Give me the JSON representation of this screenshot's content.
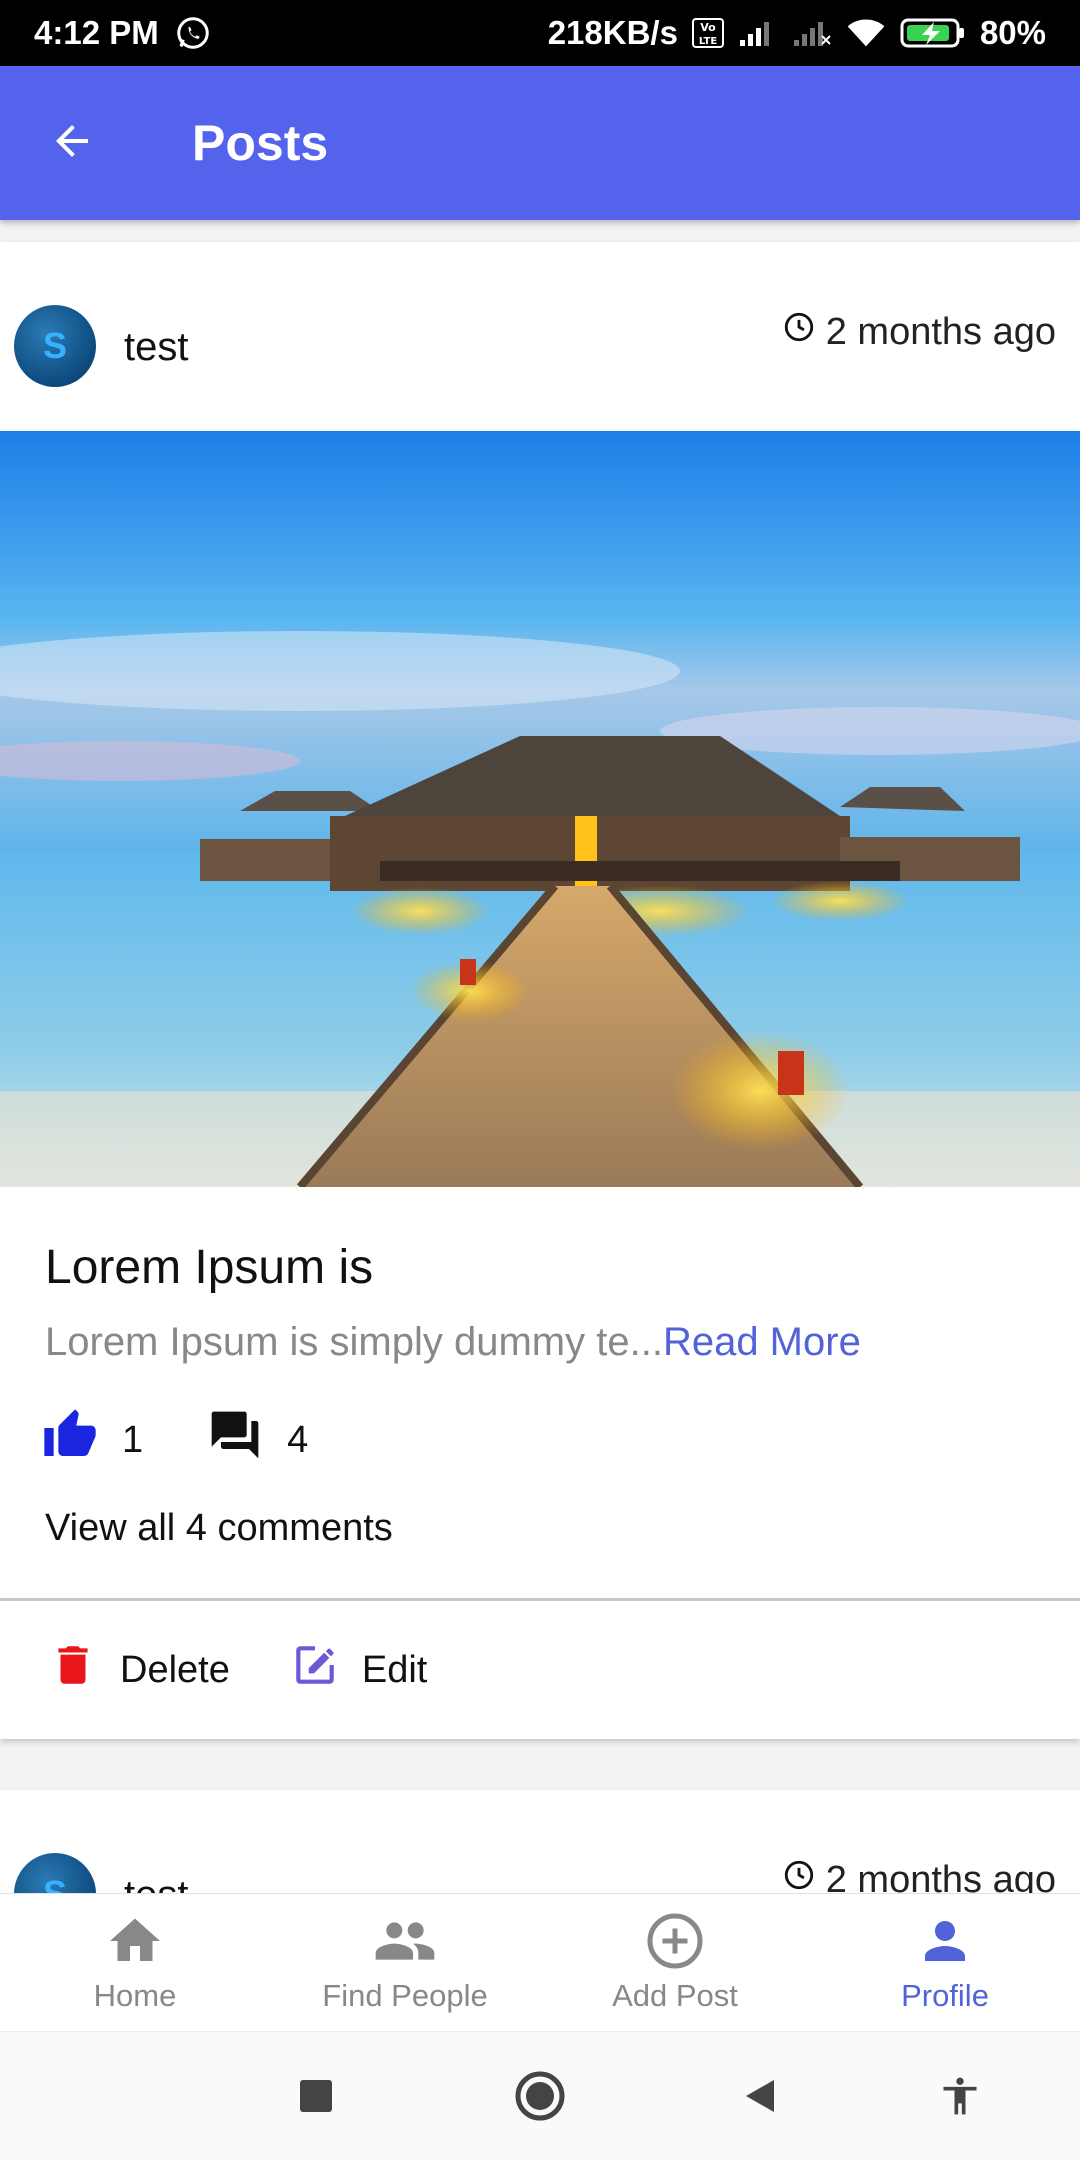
{
  "status_bar": {
    "time": "4:12 PM",
    "network_speed": "218KB/s",
    "battery": "80%",
    "icons": [
      "whatsapp-icon",
      "volte-icon",
      "signal-icon",
      "wifi-icon",
      "battery-charging-icon"
    ]
  },
  "app_bar": {
    "title": "Posts",
    "back_icon": "arrow-left-icon"
  },
  "posts": [
    {
      "author": "test",
      "avatar_letter": "S",
      "time": "2 months ago",
      "title": "Lorem Ipsum is",
      "excerpt": "Lorem Ipsum is simply dummy te...",
      "read_more": "Read More",
      "likes": "1",
      "comments": "4",
      "view_comments": "View all 4 comments",
      "delete_label": "Delete",
      "edit_label": "Edit"
    },
    {
      "author": "test",
      "avatar_letter": "S",
      "time": "2 months ago"
    }
  ],
  "bottom_nav": {
    "items": [
      {
        "label": "Home",
        "icon": "home-icon",
        "active": false
      },
      {
        "label": "Find People",
        "icon": "people-icon",
        "active": false
      },
      {
        "label": "Add Post",
        "icon": "add-circle-icon",
        "active": false
      },
      {
        "label": "Profile",
        "icon": "person-icon",
        "active": true
      }
    ]
  },
  "system_nav": [
    "recents-button",
    "home-button",
    "back-button",
    "accessibility-button"
  ],
  "colors": {
    "primary": "#5463ec",
    "link": "#5262d9",
    "like": "#1a25e0",
    "delete": "#e8161b",
    "edit": "#6a5ad8"
  }
}
